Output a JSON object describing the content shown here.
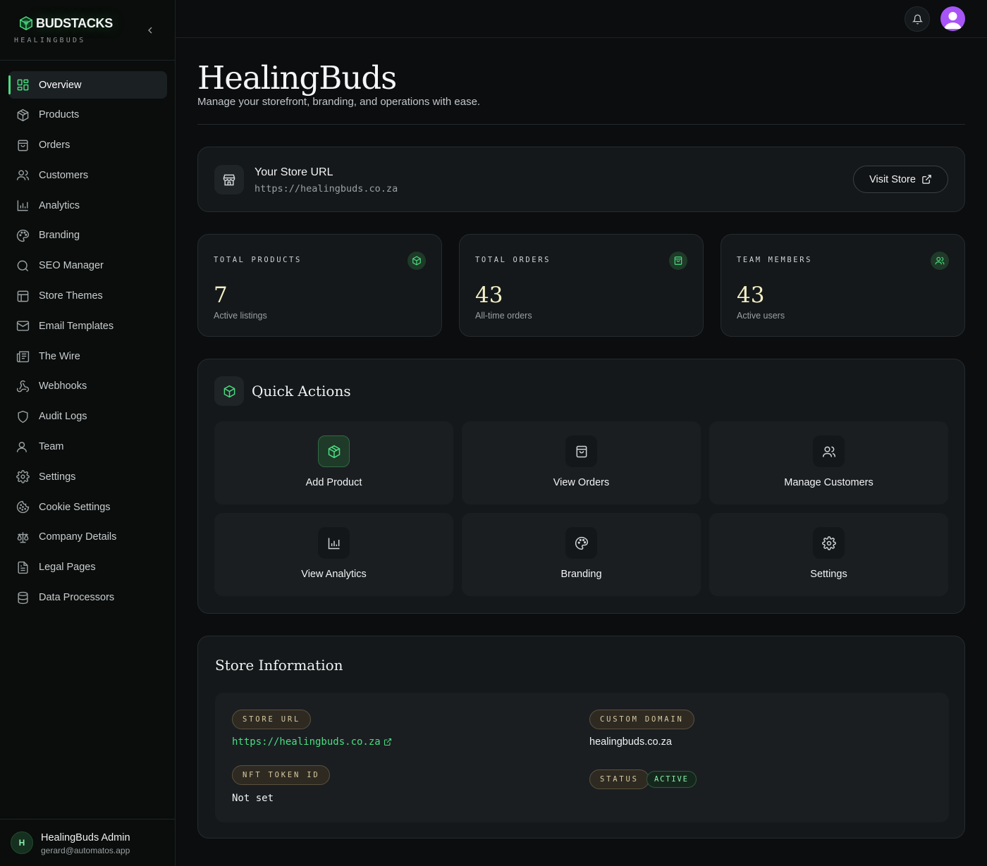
{
  "brand": {
    "name": "BUDSTACKS",
    "sub": "HEALINGBUDS"
  },
  "sidebar": {
    "items": [
      {
        "label": "Overview",
        "icon": "layout-dashboard-icon",
        "active": true
      },
      {
        "label": "Products",
        "icon": "package-icon"
      },
      {
        "label": "Orders",
        "icon": "shopping-bag-icon"
      },
      {
        "label": "Customers",
        "icon": "users-icon"
      },
      {
        "label": "Analytics",
        "icon": "bar-chart-icon"
      },
      {
        "label": "Branding",
        "icon": "palette-icon"
      },
      {
        "label": "SEO Manager",
        "icon": "search-icon"
      },
      {
        "label": "Store Themes",
        "icon": "layout-icon"
      },
      {
        "label": "Email Templates",
        "icon": "mail-icon"
      },
      {
        "label": "The Wire",
        "icon": "newspaper-icon"
      },
      {
        "label": "Webhooks",
        "icon": "webhook-icon"
      },
      {
        "label": "Audit Logs",
        "icon": "shield-icon"
      },
      {
        "label": "Team",
        "icon": "user-icon"
      },
      {
        "label": "Settings",
        "icon": "gear-icon"
      },
      {
        "label": "Cookie Settings",
        "icon": "cookie-icon"
      },
      {
        "label": "Company Details",
        "icon": "scale-icon"
      },
      {
        "label": "Legal Pages",
        "icon": "file-text-icon"
      },
      {
        "label": "Data Processors",
        "icon": "database-icon"
      }
    ],
    "user": {
      "initial": "H",
      "name": "HealingBuds Admin",
      "email": "gerard@automatos.app"
    }
  },
  "header": {
    "title": "HealingBuds",
    "subtitle": "Manage your storefront, branding, and operations with ease."
  },
  "store_url_card": {
    "title": "Your Store URL",
    "url": "https://healingbuds.co.za",
    "visit_label": "Visit Store"
  },
  "stats": [
    {
      "label": "TOTAL PRODUCTS",
      "value": "7",
      "caption": "Active listings",
      "icon": "package-icon"
    },
    {
      "label": "TOTAL ORDERS",
      "value": "43",
      "caption": "All-time orders",
      "icon": "shopping-bag-icon"
    },
    {
      "label": "TEAM MEMBERS",
      "value": "43",
      "caption": "Active users",
      "icon": "users-icon"
    }
  ],
  "quick_actions": {
    "title": "Quick Actions",
    "items": [
      {
        "label": "Add Product",
        "icon": "package-icon"
      },
      {
        "label": "View Orders",
        "icon": "shopping-bag-icon"
      },
      {
        "label": "Manage Customers",
        "icon": "users-icon"
      },
      {
        "label": "View Analytics",
        "icon": "bar-chart-icon"
      },
      {
        "label": "Branding",
        "icon": "palette-icon"
      },
      {
        "label": "Settings",
        "icon": "gear-icon"
      }
    ]
  },
  "store_info": {
    "title": "Store Information",
    "store_url_label": "STORE URL",
    "store_url": "https://healingbuds.co.za",
    "custom_domain_label": "CUSTOM DOMAIN",
    "custom_domain": "healingbuds.co.za",
    "nft_label": "NFT TOKEN ID",
    "nft_value": "Not set",
    "status_label": "STATUS",
    "status_value": "ACTIVE"
  },
  "colors": {
    "accent": "#4ade80",
    "profile": "#a855f7",
    "stat_value": "#f3eec4"
  }
}
